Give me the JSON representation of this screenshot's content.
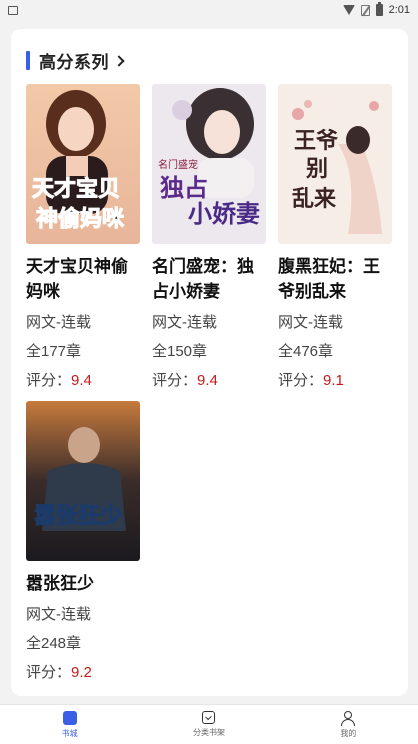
{
  "status_bar": {
    "time": "2:01"
  },
  "section": {
    "title": "高分系列"
  },
  "books": [
    {
      "cover_text": "天才宝贝神偷妈咪",
      "title": "天才宝贝神偷妈咪",
      "category": "网文-连载",
      "chapters": "全177章",
      "rating_label": "评分：",
      "rating": "9.4"
    },
    {
      "cover_text": "名门盛宠 独占小娇妻",
      "title": "名门盛宠：独占小娇妻",
      "category": "网文-连载",
      "chapters": "全150章",
      "rating_label": "评分：",
      "rating": "9.4"
    },
    {
      "cover_text": "王爷别乱来",
      "title": "腹黑狂妃：王爷别乱来",
      "category": "网文-连载",
      "chapters": "全476章",
      "rating_label": "评分：",
      "rating": "9.1"
    },
    {
      "cover_text": "嚣张狂少",
      "title": "嚣张狂少",
      "category": "网文-连载",
      "chapters": "全248章",
      "rating_label": "评分：",
      "rating": "9.2"
    }
  ],
  "nav": {
    "items": [
      {
        "label": "书城",
        "icon": "home-icon",
        "active": true
      },
      {
        "label": "分类书架",
        "icon": "shelf-icon",
        "active": false
      },
      {
        "label": "我的",
        "icon": "user-icon",
        "active": false
      }
    ]
  },
  "colors": {
    "accent": "#3a5fe5",
    "rating": "#c61a1a"
  }
}
